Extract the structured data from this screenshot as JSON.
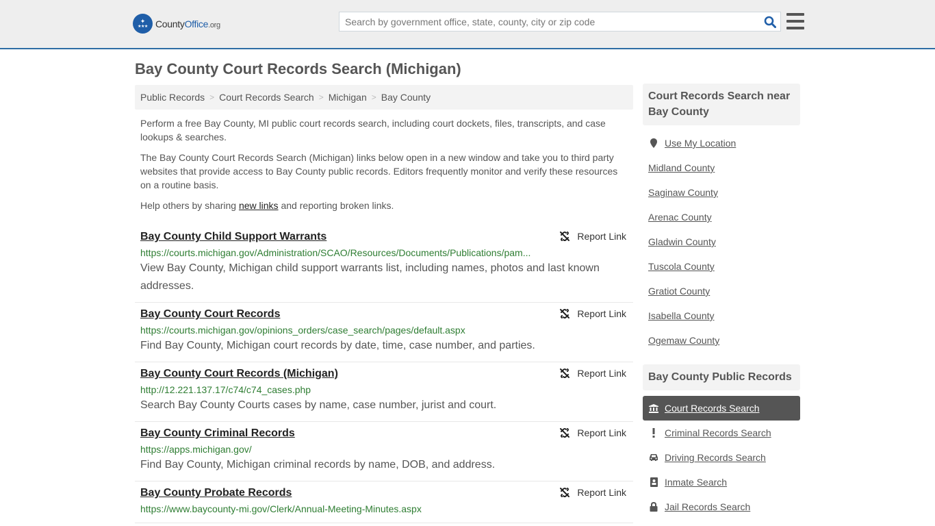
{
  "header": {
    "logo_text_main": "County",
    "logo_text_office": "Office",
    "logo_text_tld": ".org",
    "search_placeholder": "Search by government office, state, county, city or zip code",
    "search_value": "",
    "search_icon": "search-icon",
    "menu_icon": "hamburger-menu-icon"
  },
  "page": {
    "title": "Bay County Court Records Search (Michigan)"
  },
  "breadcrumb": [
    {
      "label": "Public Records"
    },
    {
      "label": "Court Records Search"
    },
    {
      "label": "Michigan"
    },
    {
      "label": "Bay County"
    }
  ],
  "breadcrumb_separator": ">",
  "intro": {
    "p1": "Perform a free Bay County, MI public court records search, including court dockets, files, transcripts, and case lookups & searches.",
    "p2": "The Bay County Court Records Search (Michigan) links below open in a new window and take you to third party websites that provide access to Bay County public records. Editors frequently monitor and verify these resources on a routine basis.",
    "p3_before": "Help others by sharing ",
    "p3_link": "new links",
    "p3_after": " and reporting broken links."
  },
  "report_label": "Report Link",
  "results": [
    {
      "title": "Bay County Child Support Warrants",
      "url": "https://courts.michigan.gov/Administration/SCAO/Resources/Documents/Publications/pam...",
      "desc": "View Bay County, Michigan child support warrants list, including names, photos and last known addresses."
    },
    {
      "title": "Bay County Court Records",
      "url": "https://courts.michigan.gov/opinions_orders/case_search/pages/default.aspx",
      "desc": "Find Bay County, Michigan court records by date, time, case number, and parties."
    },
    {
      "title": "Bay County Court Records (Michigan)",
      "url": "http://12.221.137.17/c74/c74_cases.php",
      "desc": "Search Bay County Courts cases by name, case number, jurist and court."
    },
    {
      "title": "Bay County Criminal Records",
      "url": "https://apps.michigan.gov/",
      "desc": "Find Bay County, Michigan criminal records by name, DOB, and address."
    },
    {
      "title": "Bay County Probate Records",
      "url": "https://www.baycounty-mi.gov/Clerk/Annual-Meeting-Minutes.aspx",
      "desc": ""
    }
  ],
  "sidebar": {
    "nearby_heading": "Court Records Search near Bay County",
    "use_location": "Use My Location",
    "nearby": [
      "Midland County",
      "Saginaw County",
      "Arenac County",
      "Gladwin County",
      "Tuscola County",
      "Gratiot County",
      "Isabella County",
      "Ogemaw County"
    ],
    "public_records_heading": "Bay County Public Records",
    "public_records": [
      {
        "label": "Court Records Search",
        "icon": "courthouse-icon",
        "active": true
      },
      {
        "label": "Criminal Records Search",
        "icon": "exclamation-icon",
        "active": false
      },
      {
        "label": "Driving Records Search",
        "icon": "car-icon",
        "active": false
      },
      {
        "label": "Inmate Search",
        "icon": "id-badge-icon",
        "active": false
      },
      {
        "label": "Jail Records Search",
        "icon": "lock-icon",
        "active": false
      }
    ]
  },
  "colors": {
    "brand_blue": "#1f5ea8",
    "header_border": "#2e6da4",
    "url_green": "#2e7d32",
    "active_item_bg": "#555555"
  }
}
